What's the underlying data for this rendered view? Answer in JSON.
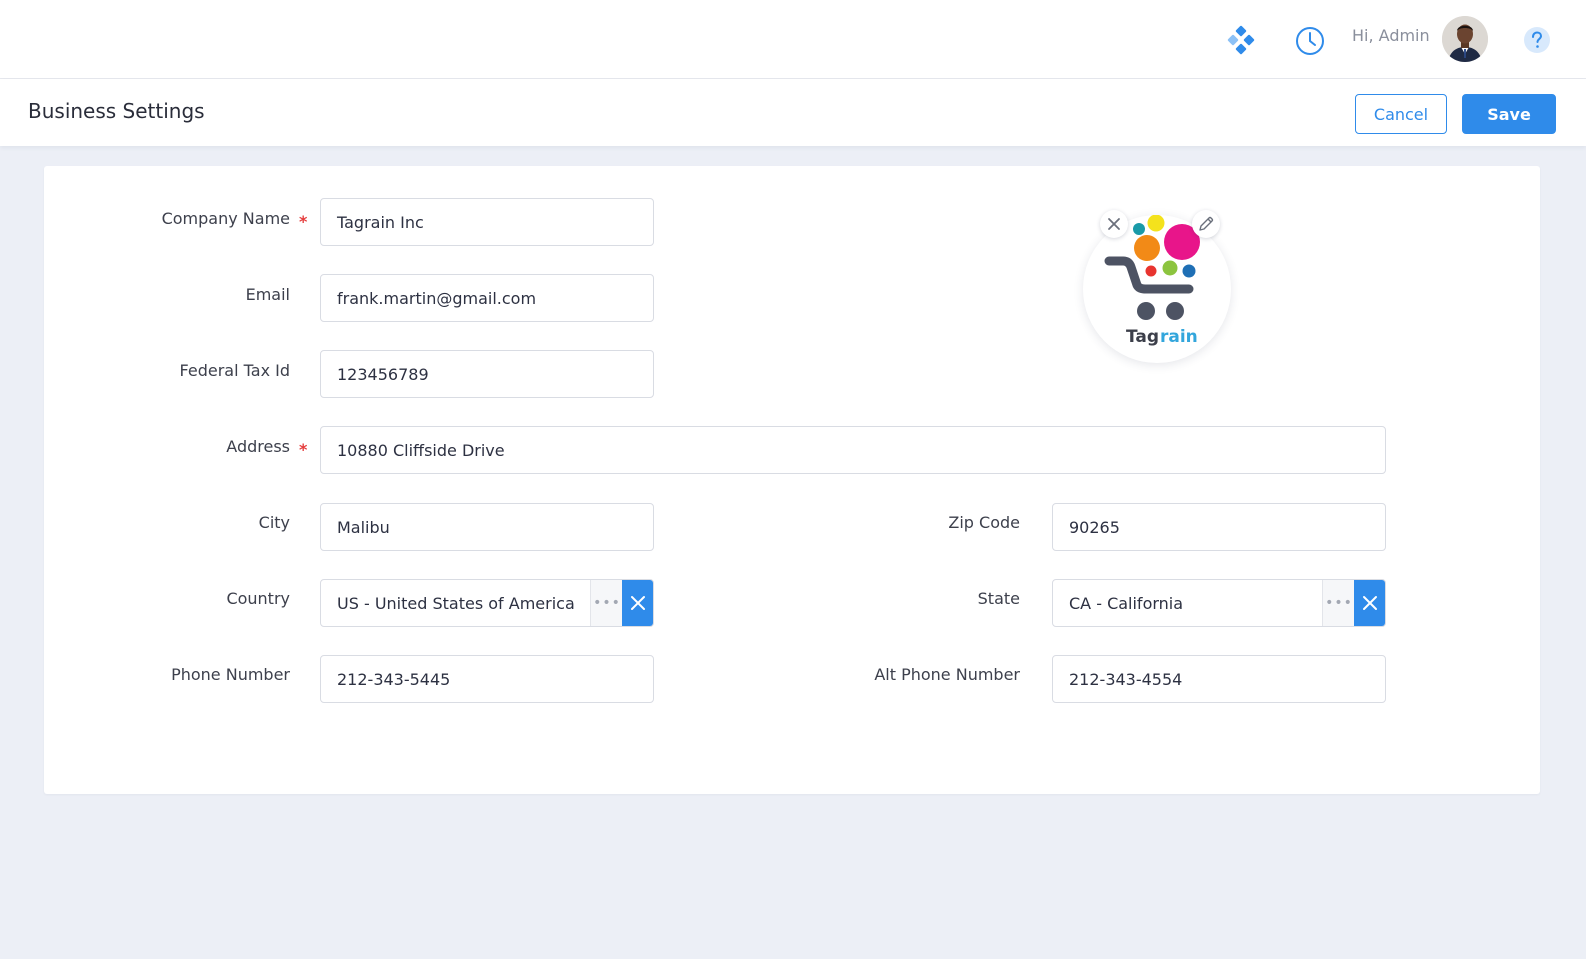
{
  "header": {
    "greeting": "Hi, Admin",
    "icons": [
      "apps-icon",
      "clock-icon",
      "avatar",
      "help-icon"
    ],
    "accent_color": "#2f8bea"
  },
  "subheader": {
    "title": "Business Settings",
    "cancel_label": "Cancel",
    "save_label": "Save"
  },
  "logo": {
    "brand_text_dark": "Tag",
    "brand_text_light": "rain"
  },
  "form": {
    "company_name": {
      "label": "Company Name",
      "value": "Tagrain Inc",
      "required": true
    },
    "email": {
      "label": "Email",
      "value": "frank.martin@gmail.com"
    },
    "federal_tax_id": {
      "label": "Federal Tax Id",
      "value": "123456789"
    },
    "address": {
      "label": "Address",
      "value": "10880 Cliffside Drive",
      "required": true
    },
    "city": {
      "label": "City",
      "value": "Malibu"
    },
    "zip_code": {
      "label": "Zip Code",
      "value": "90265"
    },
    "country": {
      "label": "Country",
      "value": "US - United States of America"
    },
    "state": {
      "label": "State",
      "value": "CA - California"
    },
    "phone_number": {
      "label": "Phone Number",
      "value": "212-343-5445"
    },
    "alt_phone_number": {
      "label": "Alt Phone Number",
      "value": "212-343-4554"
    },
    "required_marker": "*",
    "lookup_dots": "•••"
  }
}
